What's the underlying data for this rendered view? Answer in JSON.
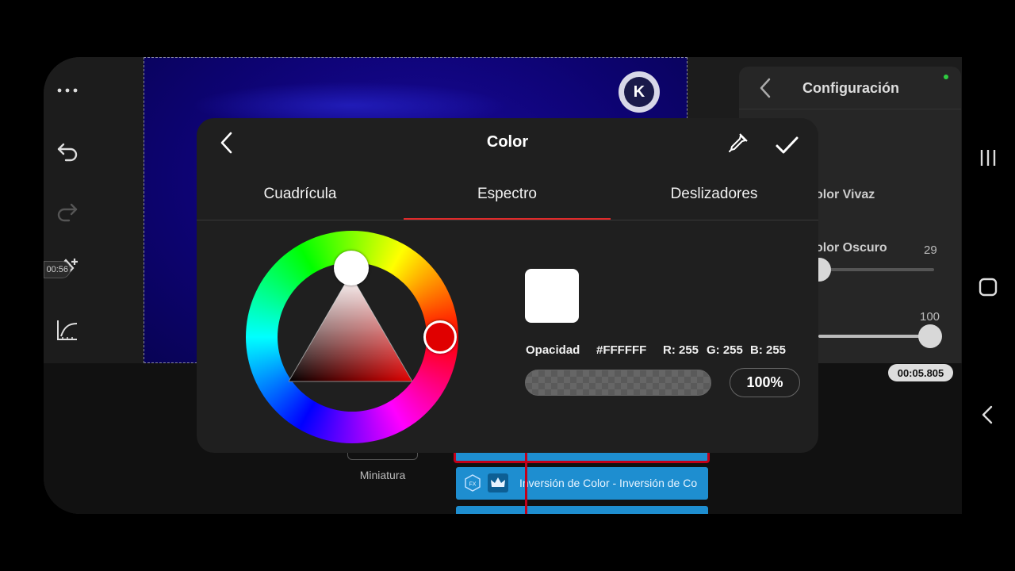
{
  "left_toolbar": {
    "timecode": "00:56"
  },
  "right_panel": {
    "title": "Configuración",
    "option1": "olor Vivaz",
    "option2": "olor Oscuro",
    "slider1_value": "29",
    "slider1_level": 0.0,
    "slider2_value": "100",
    "slider2_level": 1.0
  },
  "timeline": {
    "time": "00:05.805",
    "thumbnail_label": "Miniatura",
    "clip_label": "Inversión de Color - Inversión de Co",
    "fx_label": "FX"
  },
  "dialog": {
    "title": "Color",
    "tabs": [
      "Cuadrícula",
      "Espectro",
      "Deslizadores"
    ],
    "active_tab": "Espectro",
    "opacity_label": "Opacidad",
    "hex": "#FFFFFF",
    "r_label": "R: 255",
    "g_label": "G: 255",
    "b_label": "B: 255",
    "opacity_value": "100%",
    "selected_color": "#FFFFFF",
    "hue_color": "#E00000"
  },
  "icons": [
    "more-icon",
    "undo-icon",
    "redo-icon",
    "keyframe-add-icon",
    "curve-icon",
    "layers-icon",
    "skip-start-icon",
    "skip-end-icon",
    "back-chevron-icon",
    "eyedropper-icon",
    "check-icon",
    "recent-apps-icon",
    "home-icon",
    "nav-back-icon",
    "crown-icon"
  ]
}
